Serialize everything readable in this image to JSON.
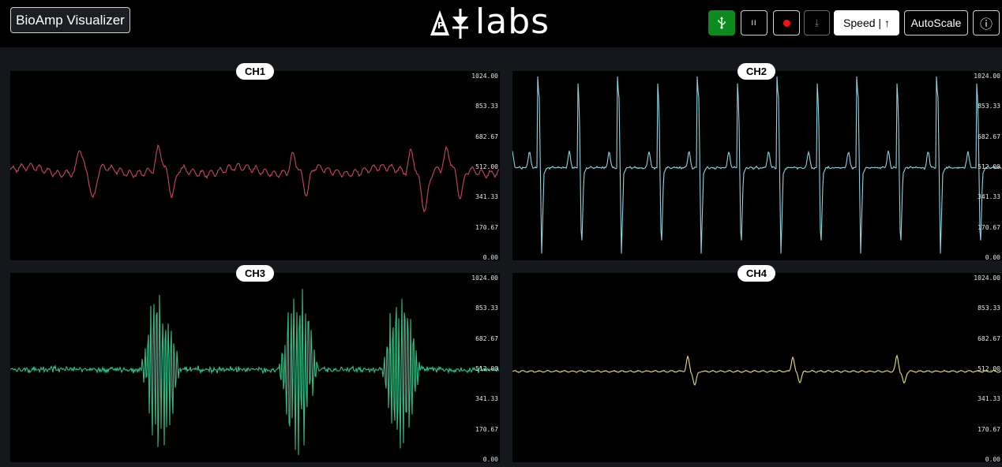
{
  "header": {
    "app_title": "BioAmp Visualizer",
    "logo_text": "labs",
    "buttons": {
      "usb": {
        "icon": "usb-icon"
      },
      "pause": {
        "icon": "pause-icon",
        "glyph": "II"
      },
      "record": {
        "icon": "record-icon"
      },
      "download": {
        "icon": "download-icon",
        "glyph": "⤓"
      },
      "speed_label": "Speed | ↑",
      "autoscale_label": "AutoScale",
      "info": {
        "icon": "info-icon",
        "glyph": "ⓘ"
      }
    }
  },
  "channels": [
    {
      "label": "CH1",
      "color": "#c8456a",
      "type": "emg"
    },
    {
      "label": "CH2",
      "color": "#8fd3df",
      "type": "ecg"
    },
    {
      "label": "CH3",
      "color": "#2fbf8a",
      "type": "burst"
    },
    {
      "label": "CH4",
      "color": "#e8e07a",
      "type": "flat"
    }
  ],
  "y_axis_ticks": [
    "1024.00",
    "853.33",
    "682.67",
    "512.00",
    "341.33",
    "170.67",
    "0.00"
  ],
  "y_axis_range": [
    0,
    1024
  ]
}
